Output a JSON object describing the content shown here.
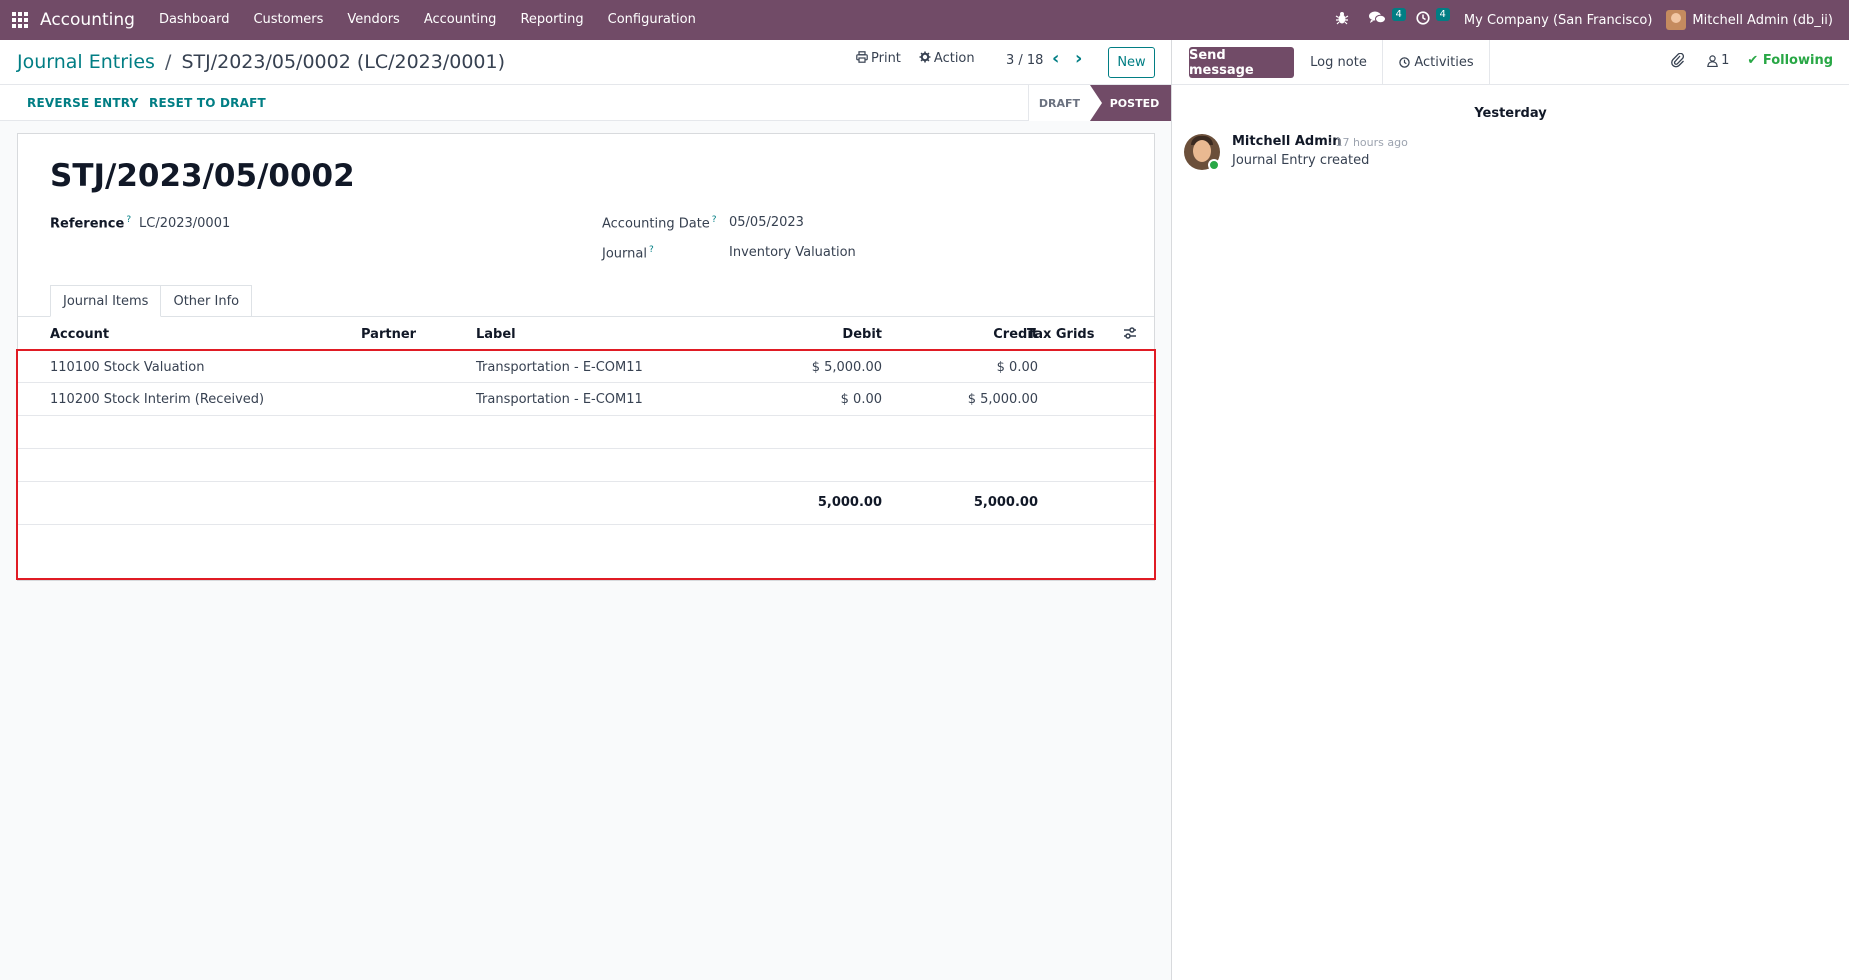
{
  "navbar": {
    "app_name": "Accounting",
    "menu": [
      "Dashboard",
      "Customers",
      "Vendors",
      "Accounting",
      "Reporting",
      "Configuration"
    ],
    "messages_badge": "4",
    "activities_badge": "4",
    "company": "My Company (San Francisco)",
    "user": "Mitchell Admin (db_ii)"
  },
  "breadcrumb": {
    "parent": "Journal Entries",
    "separator": "/",
    "current": "STJ/2023/05/0002 (LC/2023/0001)"
  },
  "actions": {
    "print": "Print",
    "action": "Action",
    "pager": "3 / 18",
    "new": "New"
  },
  "statusbar": {
    "reverse": "REVERSE ENTRY",
    "reset": "RESET TO DRAFT",
    "stages": [
      "DRAFT",
      "POSTED"
    ],
    "current_stage": "POSTED"
  },
  "form": {
    "title": "STJ/2023/05/0002",
    "reference_label": "Reference",
    "reference_value": "LC/2023/0001",
    "date_label": "Accounting Date",
    "date_value": "05/05/2023",
    "journal_label": "Journal",
    "journal_value": "Inventory Valuation",
    "help_mark": "?"
  },
  "tabs": [
    "Journal Items",
    "Other Info"
  ],
  "table": {
    "columns": [
      "Account",
      "Partner",
      "Label",
      "Debit",
      "Credit",
      "Tax Grids"
    ],
    "rows": [
      {
        "account": "110100 Stock Valuation",
        "partner": "",
        "label": "Transportation - E-COM11",
        "debit": "$ 5,000.00",
        "credit": "$ 0.00",
        "tax_grids": ""
      },
      {
        "account": "110200 Stock Interim (Received)",
        "partner": "",
        "label": "Transportation - E-COM11",
        "debit": "$ 0.00",
        "credit": "$ 5,000.00",
        "tax_grids": ""
      }
    ],
    "total_debit": "5,000.00",
    "total_credit": "5,000.00"
  },
  "chatter": {
    "send_message": "Send message",
    "log_note": "Log note",
    "activities": "Activities",
    "followers_count": "1",
    "following": "Following",
    "date_separator": "Yesterday",
    "messages": [
      {
        "author": "Mitchell Admin",
        "time": "- 17 hours ago",
        "body": "Journal Entry created"
      }
    ]
  }
}
